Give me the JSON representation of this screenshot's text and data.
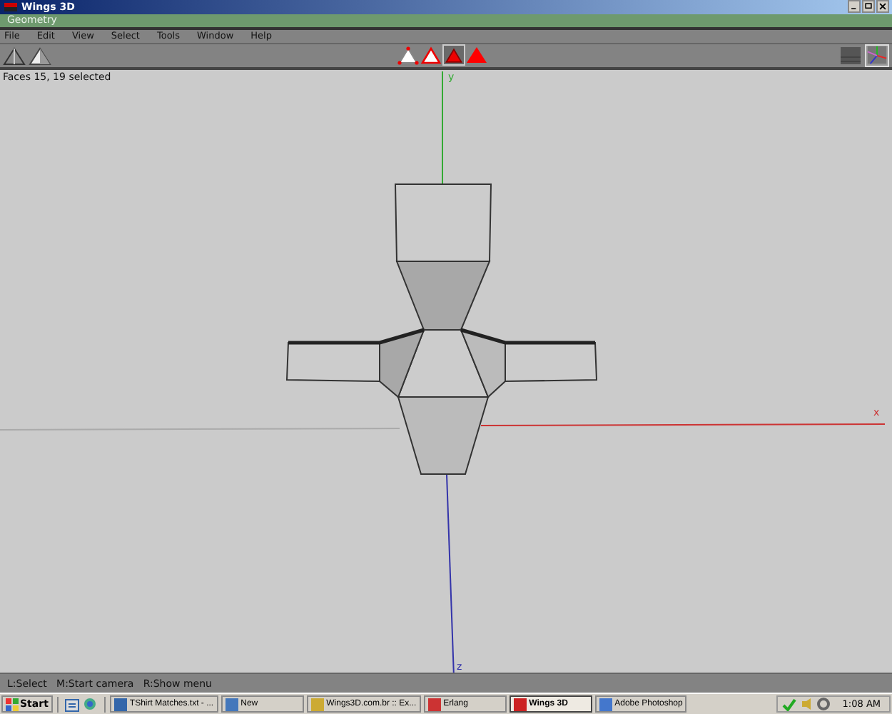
{
  "window": {
    "title": "Wings 3D"
  },
  "panel": {
    "title": "Geometry"
  },
  "menu": [
    "File",
    "Edit",
    "View",
    "Select",
    "Tools",
    "Window",
    "Help"
  ],
  "selection_modes": [
    {
      "kind": "vertex",
      "selected": false
    },
    {
      "kind": "edge",
      "selected": false
    },
    {
      "kind": "face",
      "selected": true
    },
    {
      "kind": "body",
      "selected": false
    }
  ],
  "view_toggles": [
    {
      "kind": "ground",
      "on": false
    },
    {
      "kind": "axes",
      "on": true
    }
  ],
  "viewport": {
    "info": "Faces 15, 19 selected",
    "axis_labels": [
      "y",
      "x",
      "z"
    ]
  },
  "status_bar": "L:Select   M:Start camera   R:Show menu",
  "taskbar": {
    "start": "Start",
    "tasks": [
      {
        "label": "TShirt Matches.txt - ...",
        "selected": false
      },
      {
        "label": "New",
        "selected": false
      },
      {
        "label": "Wings3D.com.br :: Ex...",
        "selected": false
      },
      {
        "label": "Erlang",
        "selected": false
      },
      {
        "label": "Wings 3D",
        "selected": true
      },
      {
        "label": "Adobe Photoshop",
        "selected": false
      }
    ],
    "time": "1:08 AM"
  }
}
